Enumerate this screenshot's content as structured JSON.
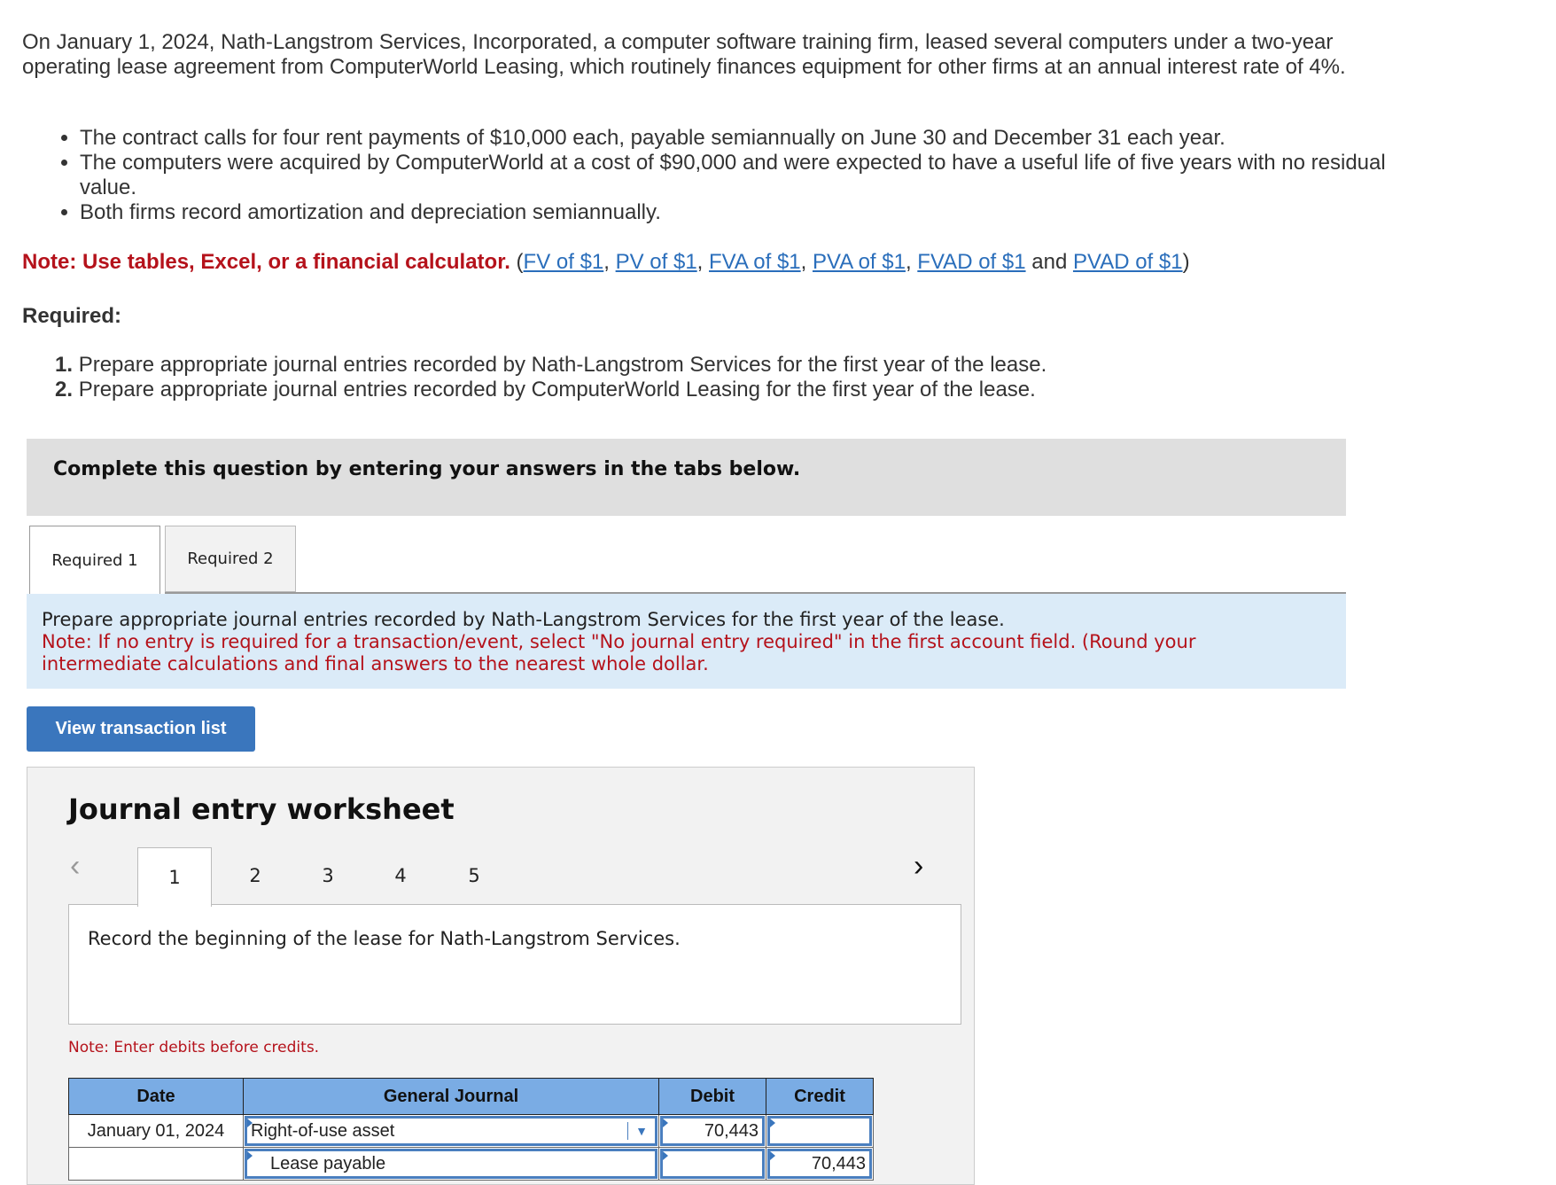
{
  "problem": {
    "intro": "On January 1, 2024, Nath-Langstrom Services, Incorporated, a computer software training firm, leased several computers under a two-year operating lease agreement from ComputerWorld Leasing, which routinely finances equipment for other firms at an annual interest rate of 4%.",
    "bullets": [
      "The contract calls for four rent payments of $10,000 each, payable semiannually on June 30 and December 31 each year.",
      "The computers were acquired by ComputerWorld at a cost of $90,000 and were expected to have a useful life of five years with no residual value.",
      "Both firms record amortization and depreciation semiannually."
    ],
    "note_label": "Note: Use tables, Excel, or a financial calculator.",
    "note_links": [
      "FV of $1",
      "PV of $1",
      "FVA of $1",
      "PVA of $1",
      "FVAD of $1",
      "PVAD of $1"
    ],
    "note_and": "and",
    "required_title": "Required:",
    "required_items": [
      {
        "num": "1.",
        "text": "Prepare appropriate journal entries recorded by Nath-Langstrom Services for the first year of the lease."
      },
      {
        "num": "2.",
        "text": "Prepare appropriate journal entries recorded by ComputerWorld Leasing for the first year of the lease."
      }
    ]
  },
  "banner": "Complete this question by entering your answers in the tabs below.",
  "tabs": [
    {
      "label": "Required 1",
      "active": true
    },
    {
      "label": "Required 2",
      "active": false
    }
  ],
  "instructions": {
    "line1": "Prepare appropriate journal entries recorded by Nath-Langstrom Services for the first year of the lease.",
    "line2": "Note: If no entry is required for a transaction/event, select \"No journal entry required\" in the first account field. (Round your intermediate calculations and final answers to the nearest whole dollar."
  },
  "view_button": "View transaction list",
  "worksheet": {
    "title": "Journal entry worksheet",
    "prev_icon": "‹",
    "next_icon": "›",
    "steps": [
      "1",
      "2",
      "3",
      "4",
      "5"
    ],
    "active_step": "1",
    "description": "Record the beginning of the lease for Nath-Langstrom Services.",
    "note": "Note: Enter debits before credits.",
    "table": {
      "headers": [
        "Date",
        "General Journal",
        "Debit",
        "Credit"
      ],
      "rows": [
        {
          "date": "January 01, 2024",
          "account": "Right-of-use asset",
          "debit": "70,443",
          "credit": ""
        },
        {
          "date": "",
          "account": "Lease payable",
          "debit": "",
          "credit": "70,443"
        }
      ]
    }
  },
  "colors": {
    "accent_blue": "#3a76bd",
    "note_red": "#b5121b",
    "link_blue": "#2a6ebb",
    "table_header": "#7aace4",
    "instruction_bg": "#dbebf8"
  }
}
